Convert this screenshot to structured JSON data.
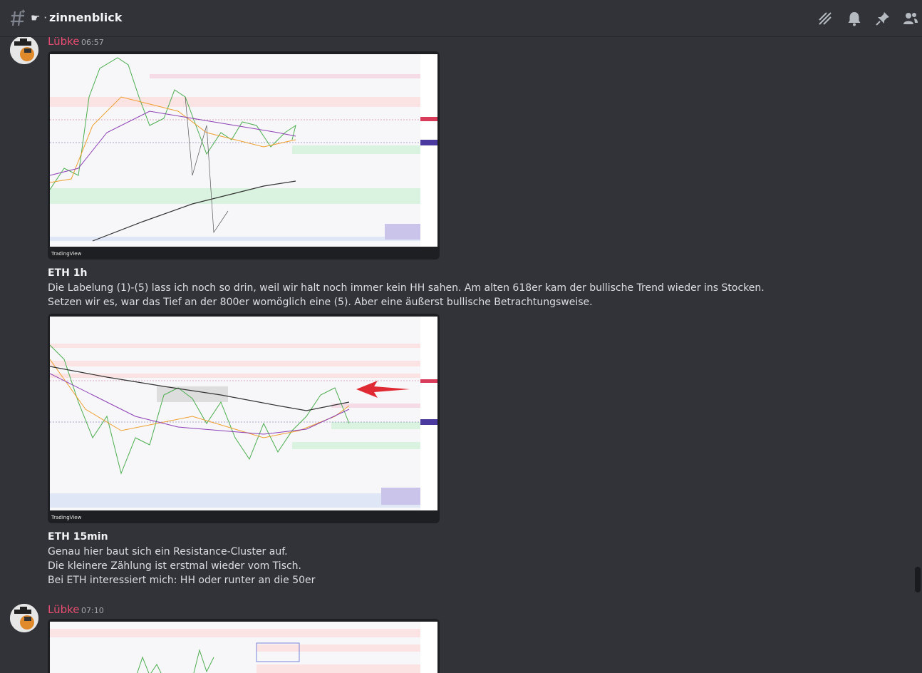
{
  "channel": {
    "prefix": "☛ ·",
    "name": "zinnenblick"
  },
  "toolbar_icons": [
    "threads-icon",
    "bell-icon",
    "pin-icon",
    "members-icon"
  ],
  "messages": [
    {
      "author": "Lübke",
      "time": "06:57",
      "attachment_footer": "TradingView",
      "title": "ETH 1h",
      "lines": [
        "Die Labelung (1)-(5) lass ich noch so drin, weil wir halt noch immer kein HH sahen. Am alten 618er kam der bullische Trend wieder ins Stocken.",
        "Setzen wir es, war das Tief an der 800er womöglich eine (5). Aber eine äußerst bullische Betrachtungsweise."
      ]
    },
    {
      "attachment_footer": "TradingView",
      "title": "ETH 15min",
      "lines": [
        "Genau hier baut sich ein Resistance-Cluster auf.",
        "Die kleinere Zählung ist erstmal wieder vom Tisch.",
        "Bei ETH interessiert mich: HH oder runter an die 50er"
      ]
    },
    {
      "author": "Lübke",
      "time": "07:10"
    }
  ],
  "colors": {
    "background": "#313338",
    "author": "#e84c6f",
    "text": "#dbdee1"
  }
}
